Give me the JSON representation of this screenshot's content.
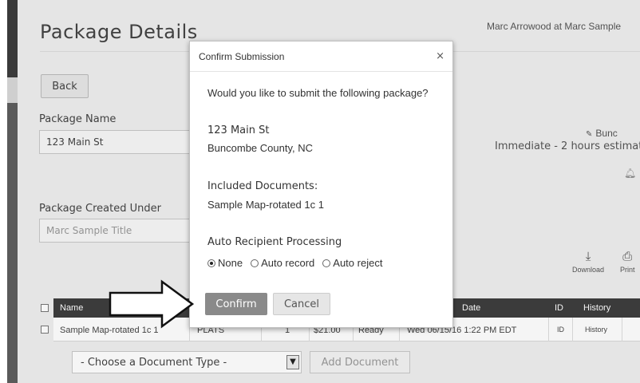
{
  "page": {
    "title": "Package Details",
    "user_line": "Marc Arrowood at Marc Sample",
    "back_label": "Back",
    "package_name_label": "Package Name",
    "package_name_value": "123 Main St",
    "created_under_label": "Package Created Under",
    "created_under_placeholder": "Marc Sample Title",
    "county_link": "Bunc",
    "timing": "Immediate - 2 hours estimat",
    "download_label": "Download",
    "print_label": "Print"
  },
  "table": {
    "headers": [
      "Name",
      "Date",
      "ID",
      "History"
    ],
    "rows": [
      {
        "name": "Sample Map-rotated 1c 1",
        "type": "PLATS",
        "qty": "1",
        "fee": "$21.00",
        "status": "Ready",
        "date": "Wed 06/15/16 1:22 PM EDT",
        "id": "ID",
        "history": "History"
      }
    ]
  },
  "footer": {
    "doc_type_select": "- Choose a Document Type -",
    "add_document_label": "Add Document"
  },
  "modal": {
    "title": "Confirm Submission",
    "close_symbol": "×",
    "question": "Would you like to submit the following package?",
    "address_line1": "123 Main St",
    "address_line2": "Buncombe County, NC",
    "included_label": "Included Documents:",
    "included_doc": "Sample Map-rotated 1c 1",
    "auto_label": "Auto Recipient Processing",
    "options": [
      "None",
      "Auto record",
      "Auto reject"
    ],
    "selected_option": "None",
    "confirm_label": "Confirm",
    "cancel_label": "Cancel"
  }
}
